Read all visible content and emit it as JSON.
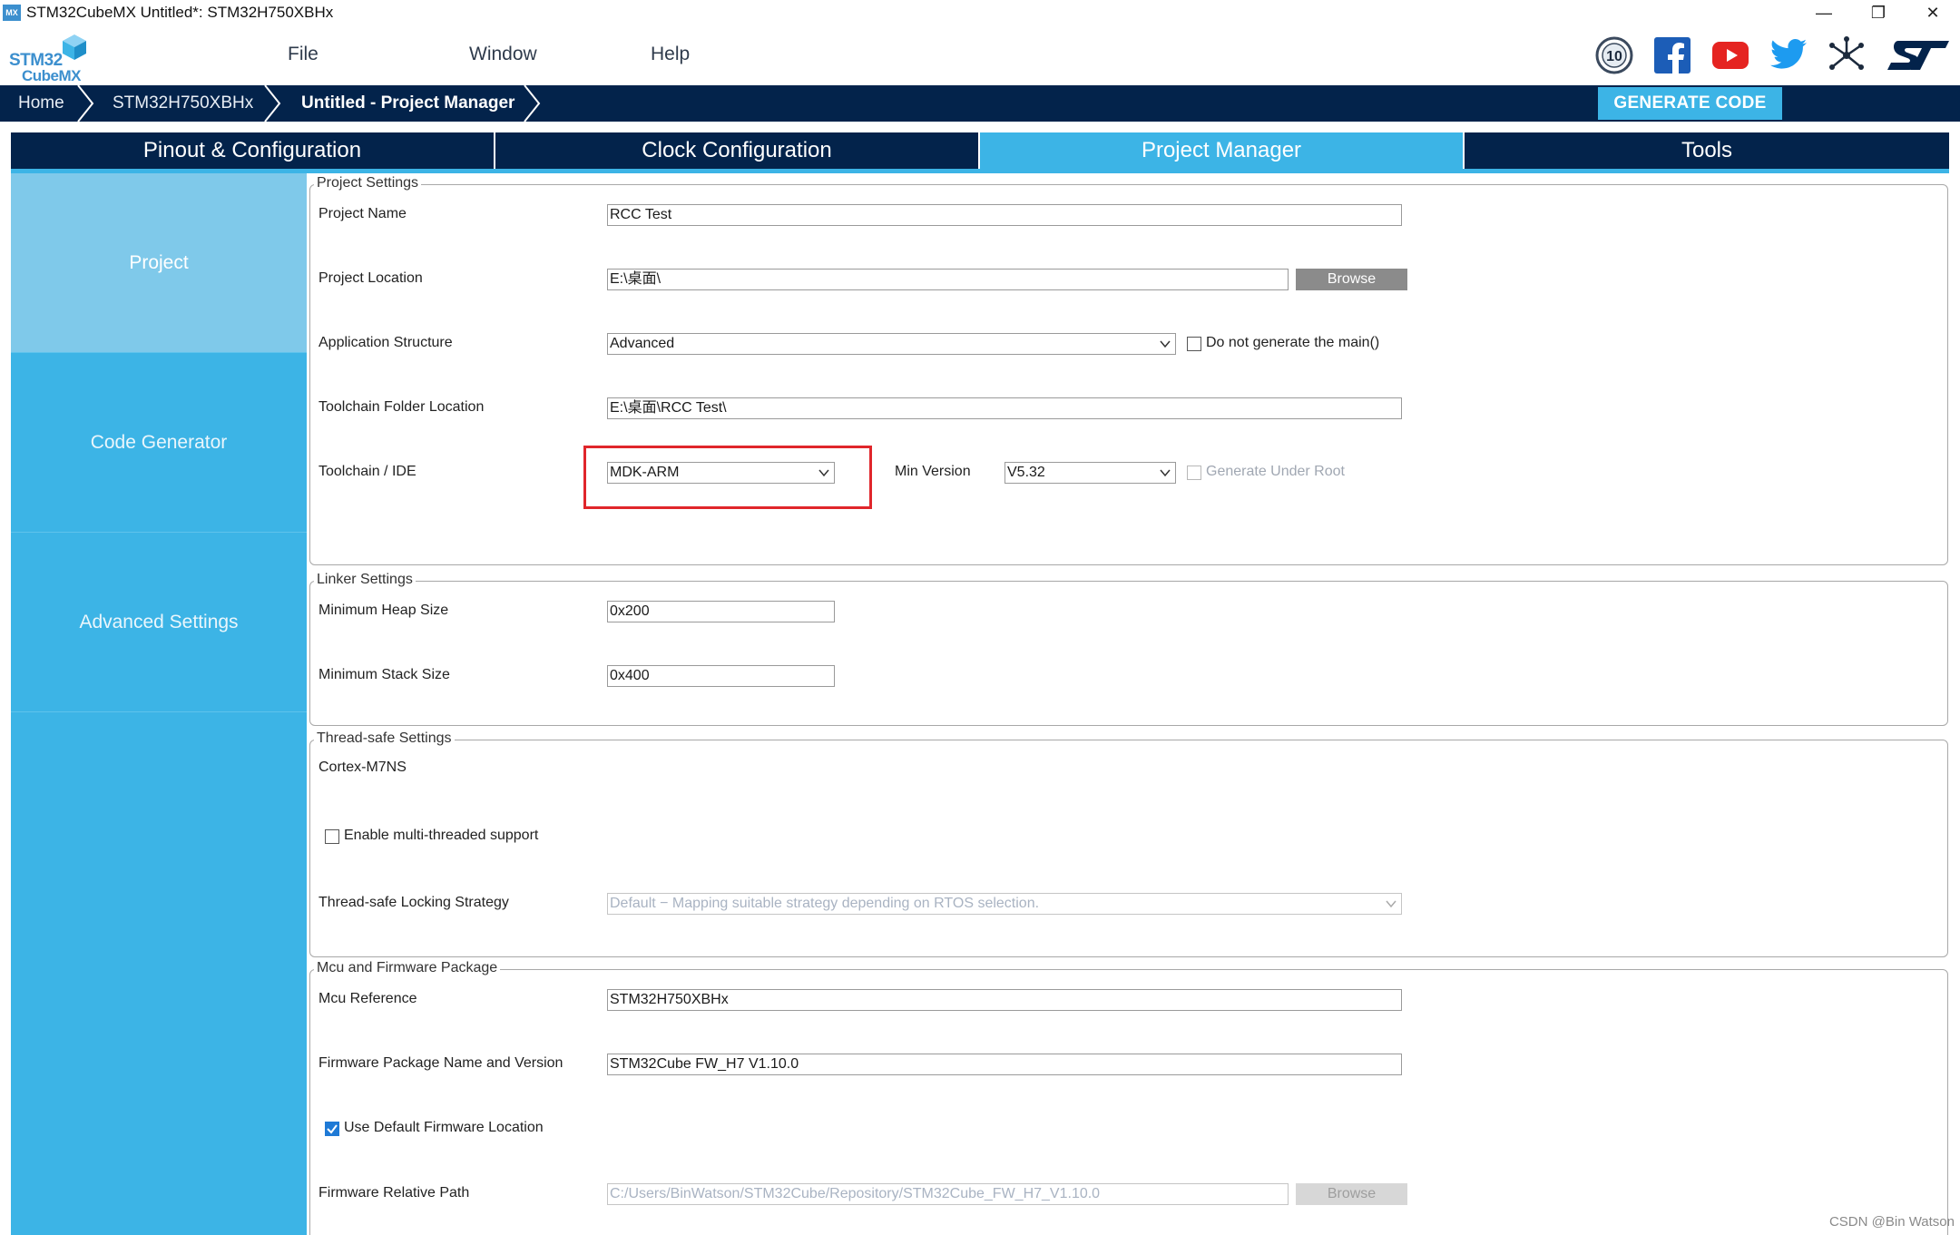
{
  "window": {
    "icon_text": "MX",
    "title": "STM32CubeMX Untitled*: STM32H750XBHx",
    "controls": {
      "minimize": "—",
      "restore": "❐",
      "close": "✕"
    }
  },
  "logo": {
    "line1": "STM32",
    "line2": "CubeMX"
  },
  "menu": {
    "file": "File",
    "window": "Window",
    "help": "Help"
  },
  "badge": {
    "text": "10"
  },
  "breadcrumb": {
    "home": "Home",
    "device": "STM32H750XBHx",
    "current": "Untitled - Project Manager"
  },
  "generate_button": "GENERATE CODE",
  "tabs": [
    "Pinout & Configuration",
    "Clock Configuration",
    "Project Manager",
    "Tools"
  ],
  "leftnav": [
    "Project",
    "Code Generator",
    "Advanced Settings"
  ],
  "project_settings": {
    "title": "Project Settings",
    "project_name_label": "Project Name",
    "project_name": "RCC Test",
    "project_location_label": "Project Location",
    "project_location": "E:\\桌面\\",
    "browse": "Browse",
    "app_structure_label": "Application Structure",
    "app_structure": "Advanced",
    "no_main_label": "Do not generate the main()",
    "toolchain_folder_label": "Toolchain Folder Location",
    "toolchain_folder": "E:\\桌面\\RCC Test\\",
    "toolchain_label": "Toolchain / IDE",
    "toolchain": "MDK-ARM",
    "min_version_label": "Min Version",
    "min_version": "V5.32",
    "gen_under_root_label": "Generate Under Root"
  },
  "linker_settings": {
    "title": "Linker Settings",
    "heap_label": "Minimum Heap Size",
    "heap": "0x200",
    "stack_label": "Minimum Stack Size",
    "stack": "0x400"
  },
  "thread_safe": {
    "title": "Thread-safe Settings",
    "core": "Cortex-M7NS",
    "multithread_label": "Enable multi-threaded support",
    "locking_label": "Thread-safe Locking Strategy",
    "locking": "Default  −  Mapping suitable strategy depending on RTOS selection."
  },
  "mcu_firmware": {
    "title": "Mcu and Firmware Package",
    "mcu_ref_label": "Mcu Reference",
    "mcu_ref": "STM32H750XBHx",
    "fw_name_label": "Firmware Package Name and Version",
    "fw_name": "STM32Cube FW_H7 V1.10.0",
    "use_default_label": "Use Default Firmware Location",
    "fw_path_label": "Firmware Relative Path",
    "fw_path": "C:/Users/BinWatson/STM32Cube/Repository/STM32Cube_FW_H7_V1.10.0",
    "browse": "Browse"
  },
  "watermark": "CSDN @Bin Watson"
}
